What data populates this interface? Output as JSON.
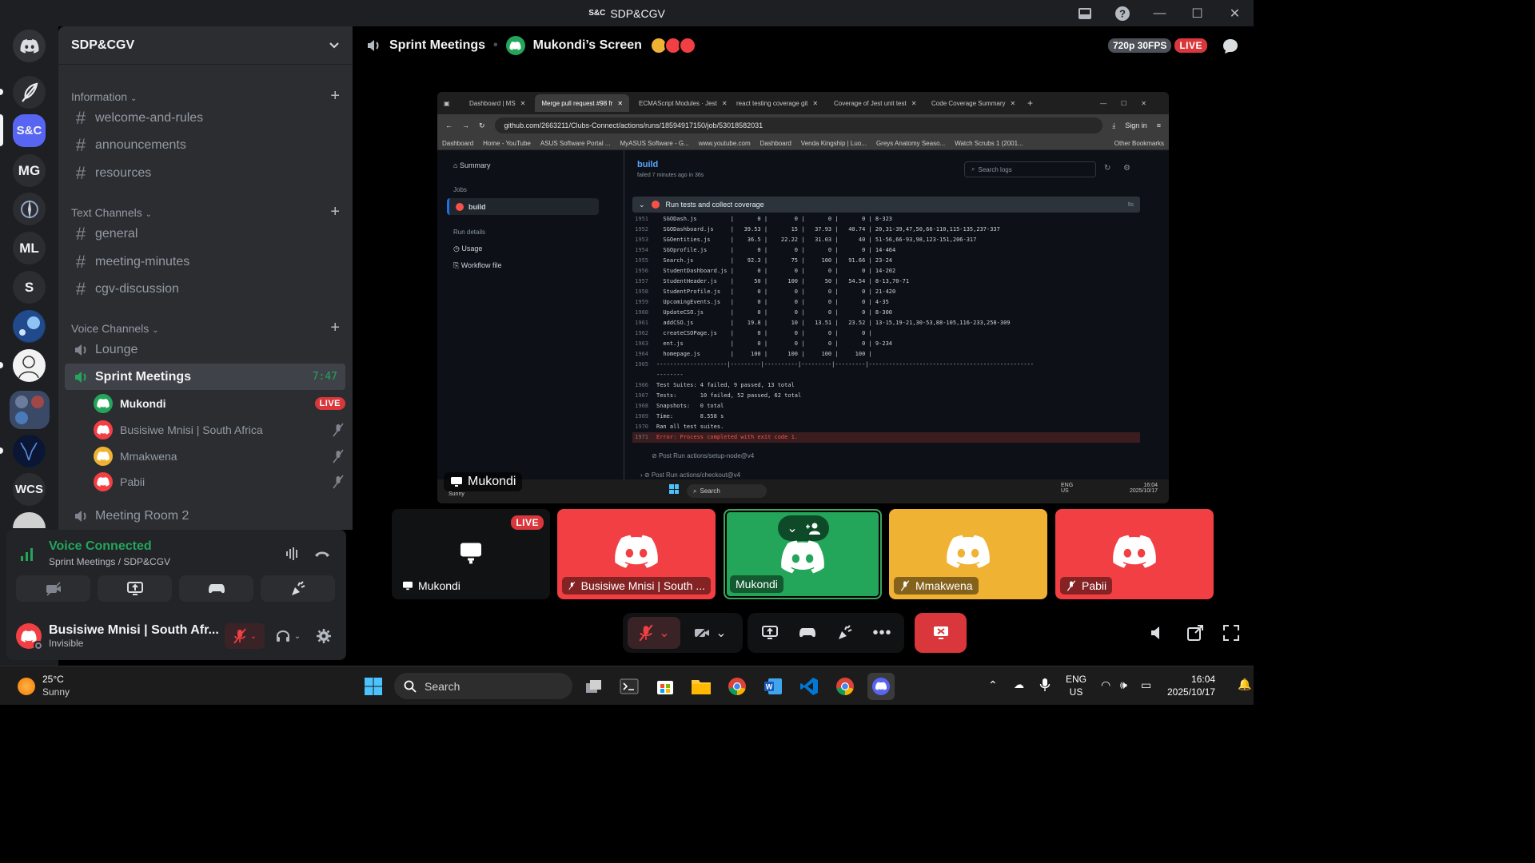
{
  "window": {
    "logo_text": "S&C",
    "title": "SDP&CGV"
  },
  "server_rail": {
    "servers": [
      {
        "label": "S&C",
        "color": "#5865f2"
      },
      {
        "label": "MG",
        "color": "#2b2d31"
      },
      {
        "label": "ML",
        "color": "#2b2d31"
      },
      {
        "label": "S",
        "color": "#2b2d31"
      },
      {
        "label": "WCS",
        "color": "#2b2d31"
      }
    ]
  },
  "sidebar": {
    "server_name": "SDP&CGV",
    "categories": {
      "information": "Information",
      "text": "Text Channels",
      "voice": "Voice Channels"
    },
    "info_channels": [
      "welcome-and-rules",
      "announcements",
      "resources"
    ],
    "text_channels": [
      "general",
      "meeting-minutes",
      "cgv-discussion"
    ],
    "voice_channels": {
      "lounge": "Lounge",
      "sprint": "Sprint Meetings",
      "sprint_timer": "7:47",
      "room2": "Meeting Room 2"
    },
    "voice_users": [
      {
        "name": "Mukondi",
        "color": "#23a55a",
        "badge": "LIVE"
      },
      {
        "name": "Busisiwe Mnisi | South Africa",
        "color": "#f23f43"
      },
      {
        "name": "Mmakwena",
        "color": "#f0b232"
      },
      {
        "name": "Pabii",
        "color": "#f23f43"
      }
    ]
  },
  "voice_panel": {
    "status": "Voice Connected",
    "location": "Sprint Meetings / SDP&CGV"
  },
  "user_panel": {
    "name": "Busisiwe Mnisi | South Afr...",
    "status": "Invisible"
  },
  "stage": {
    "channel": "Sprint Meetings",
    "stream_title": "Mukondi’s Screen",
    "quality": "720p 30FPS",
    "live": "LIVE",
    "stream_owner": "Mukondi"
  },
  "shared_screen": {
    "tabs": [
      "Dashboard | MS",
      "Merge pull request #98 fr",
      "ECMAScript Modules · Jest",
      "react testing coverage git",
      "Coverage of Jest unit test",
      "Code Coverage Summary"
    ],
    "url": "github.com/2663211/Clubs-Connect/actions/runs/18594917150/job/53018582031",
    "sign_in": "Sign in",
    "bookmarks": [
      "Dashboard",
      "Home - YouTube",
      "ASUS Software Portal ...",
      "MyASUS Software - G...",
      "www.youtube.com",
      "Dashboard",
      "Venda Kingship | Luo...",
      "Greys Anatomy Seaso...",
      "Watch Scrubs 1 (2001...",
      "Other Bookmarks"
    ],
    "nav": {
      "summary": "Summary",
      "jobs": "Jobs",
      "build": "build",
      "run_details": "Run details",
      "usage": "Usage",
      "workflow": "Workflow file"
    },
    "job_title": "build",
    "job_meta": "failed 7 minutes ago in 36s",
    "search_placeholder": "Search logs",
    "step": "Run tests and collect coverage",
    "step_time": "9s",
    "log_lines": [
      {
        "n": "1951",
        "t": "  SGODash.js          |       0 |        0 |       0 |       0 | 8-323"
      },
      {
        "n": "1952",
        "t": "  SGODashboard.js     |   39.53 |       15 |   37.93 |   40.74 | 20,31-39,47,50,66-110,115-135,237-337"
      },
      {
        "n": "1953",
        "t": "  SGOentities.js      |    36.5 |    22.22 |   31.03 |      40 | 51-56,66-93,98,123-151,206-317"
      },
      {
        "n": "1954",
        "t": "  SGOprofile.js       |       0 |        0 |       0 |       0 | 14-464"
      },
      {
        "n": "1955",
        "t": "  Search.js           |    92.3 |       75 |     100 |   91.66 | 23-24"
      },
      {
        "n": "1956",
        "t": "  StudentDashboard.js |       0 |        0 |       0 |       0 | 14-202"
      },
      {
        "n": "1957",
        "t": "  StudentHeader.js    |      50 |      100 |      50 |   54.54 | 8-13,70-71"
      },
      {
        "n": "1958",
        "t": "  StudentProfile.js   |       0 |        0 |       0 |       0 | 21-420"
      },
      {
        "n": "1959",
        "t": "  UpcomingEvents.js   |       0 |        0 |       0 |       0 | 4-35"
      },
      {
        "n": "1960",
        "t": "  UpdateCSO.js        |       0 |        0 |       0 |       0 | 8-300"
      },
      {
        "n": "1961",
        "t": "  addCSO.js           |    19.8 |       10 |   13.51 |   23.52 | 13-15,19-21,30-53,88-105,116-233,258-309"
      },
      {
        "n": "1962",
        "t": "  createCSOPage.js    |       0 |        0 |       0 |       0 |"
      },
      {
        "n": "1963",
        "t": "  ent.js              |       0 |        0 |       0 |       0 | 9-234"
      },
      {
        "n": "1964",
        "t": "  homepage.js         |     100 |      100 |     100 |     100 |"
      },
      {
        "n": "1965",
        "t": "---------------------|---------|----------|---------|---------|-------------------------------------------------"
      },
      {
        "n": "",
        "t": "--------"
      },
      {
        "n": "1966",
        "t": "Test Suites: 4 failed, 9 passed, 13 total"
      },
      {
        "n": "1967",
        "t": "Tests:       10 failed, 52 passed, 62 total"
      },
      {
        "n": "1968",
        "t": "Snapshots:   0 total"
      },
      {
        "n": "1969",
        "t": "Time:        8.558 s"
      },
      {
        "n": "1970",
        "t": "Ran all test suites."
      },
      {
        "n": "1971",
        "t": "Error: Process completed with exit code 1."
      }
    ],
    "post_steps": [
      "Post Run actions/setup-node@v4",
      "Post Run actions/checkout@v4"
    ],
    "inner_search": "Search",
    "inner_lang": "ENG\nUS",
    "inner_time": "16:04",
    "inner_date": "2025/10/17",
    "weather_sub": "Sunny"
  },
  "tiles": [
    {
      "name": "Mukondi",
      "bg": "#111214",
      "badge": "LIVE"
    },
    {
      "name": "Busisiwe Mnisi | South ...",
      "bg": "#f23f43"
    },
    {
      "name": "Mukondi",
      "bg": "#23a55a"
    },
    {
      "name": "Mmakwena",
      "bg": "#f0b232"
    },
    {
      "name": "Pabii",
      "bg": "#f23f43"
    }
  ],
  "taskbar": {
    "temp": "25°C",
    "weather": "Sunny",
    "search": "Search",
    "lang1": "ENG",
    "lang2": "US",
    "time": "16:04",
    "date": "2025/10/17"
  }
}
